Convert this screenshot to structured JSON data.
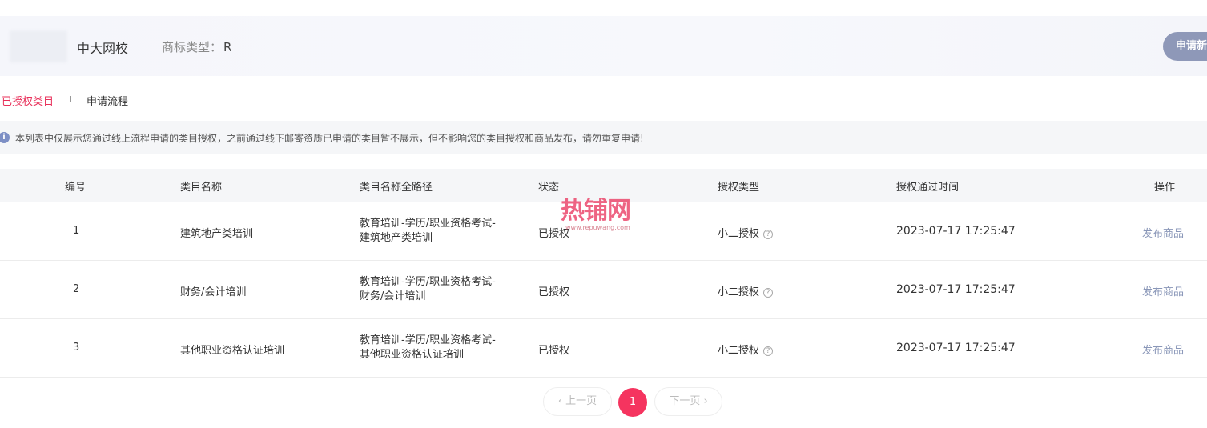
{
  "header": {
    "shop_name": "中大网校",
    "trademark_label": "商标类型：",
    "trademark_value": "R",
    "apply_button": "申请新"
  },
  "tabs": [
    {
      "label": "已授权类目",
      "active": true
    },
    {
      "label": "申请流程",
      "active": false
    }
  ],
  "notice": {
    "icon": "info-icon",
    "text": "本列表中仅展示您通过线上流程申请的类目授权，之前通过线下邮寄资质已申请的类目暂不展示，但不影响您的类目授权和商品发布，请勿重复申请!"
  },
  "table": {
    "headers": [
      "编号",
      "类目名称",
      "类目名称全路径",
      "状态",
      "授权类型",
      "授权通过时间",
      "操作"
    ],
    "rows": [
      {
        "id": "1",
        "name": "建筑地产类培训",
        "path_line1": "教育培训-学历/职业资格考试-",
        "path_line2": "建筑地产类培训",
        "status": "已授权",
        "auth_type": "小二授权",
        "time": "2023-07-17 17:25:47",
        "action": "发布商品"
      },
      {
        "id": "2",
        "name": "财务/会计培训",
        "path_line1": "教育培训-学历/职业资格考试-",
        "path_line2": "财务/会计培训",
        "status": "已授权",
        "auth_type": "小二授权",
        "time": "2023-07-17 17:25:47",
        "action": "发布商品"
      },
      {
        "id": "3",
        "name": "其他职业资格认证培训",
        "path_line1": "教育培训-学历/职业资格考试-",
        "path_line2": "其他职业资格认证培训",
        "status": "已授权",
        "auth_type": "小二授权",
        "time": "2023-07-17 17:25:47",
        "action": "发布商品"
      }
    ]
  },
  "pagination": {
    "prev": "‹ 上一页",
    "current": "1",
    "next": "下一页 ›"
  },
  "watermark": {
    "text": "热铺网",
    "url": "www.repuwang.com"
  },
  "colors": {
    "accent": "#f5345f",
    "active_tab": "#e8305a",
    "link": "#8a97b8",
    "header_bg": "#f5f6fb"
  }
}
